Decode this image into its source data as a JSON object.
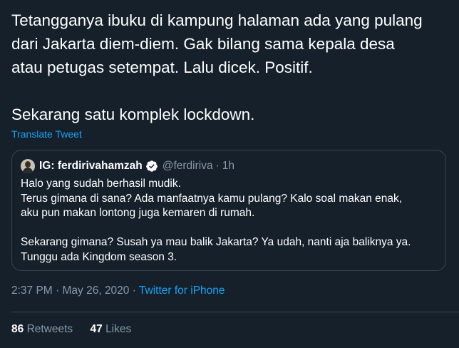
{
  "tweet": {
    "text": "Tetangganya ibuku di kampung halaman ada yang pulang\ndari Jakarta diem-diem. Gak bilang sama kepala desa\natau petugas setempat. Lalu dicek. Positif.\n\nSekarang satu komplek lockdown.",
    "translate_label": "Translate Tweet"
  },
  "quote": {
    "name": "IG: ferdirivahamzah",
    "handle": "@ferdiriva",
    "separator": "·",
    "time": "1h",
    "verified_icon": "verified-badge-icon",
    "text": "Halo yang sudah berhasil mudik.\nTerus gimana di sana? Ada manfaatnya kamu pulang? Kalo soal makan enak,\naku pun makan lontong juga kemaren di rumah.\n\nSekarang gimana? Susah ya mau balik Jakarta? Ya udah, nanti aja baliknya ya.\nTunggu ada Kingdom season 3."
  },
  "meta": {
    "timestamp": "2:37 PM · May 26, 2020 ·",
    "source": "Twitter for iPhone"
  },
  "stats": {
    "retweets_count": "86",
    "retweets_label": "Retweets",
    "likes_count": "47",
    "likes_label": "Likes"
  },
  "colors": {
    "background": "#15202b",
    "accent": "#1da1f2",
    "secondary_text": "#8899a6",
    "border": "#38444d"
  }
}
